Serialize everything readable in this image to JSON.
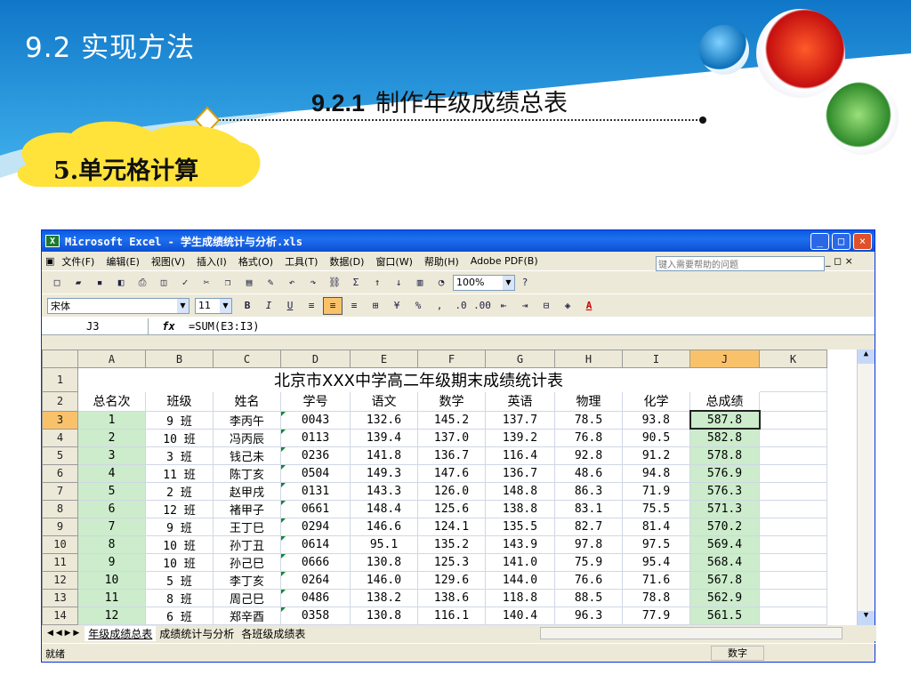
{
  "slide": {
    "section_title": "9.2  实现方法",
    "subtitle_num": "9.2.1",
    "subtitle_text": "制作年级成绩总表",
    "cloud_label": "5.单元格计算"
  },
  "window": {
    "title": "Microsoft Excel - 学生成绩统计与分析.xls",
    "buttons": {
      "minimize": "_",
      "maximize": "□",
      "close": "×"
    }
  },
  "menu": {
    "items": [
      "文件(F)",
      "编辑(E)",
      "视图(V)",
      "插入(I)",
      "格式(O)",
      "工具(T)",
      "数据(D)",
      "窗口(W)",
      "帮助(H)",
      "Adobe PDF(B)"
    ],
    "ask_placeholder": "键入需要帮助的问题",
    "doc_controls": "▾ _ ◻ ×"
  },
  "toolbar": {
    "zoom": "100%",
    "font_name": "宋体",
    "font_size": "11",
    "bold": "B",
    "italic": "I",
    "underline": "U",
    "percent": "%",
    "comma": ",",
    "sigma": "Σ"
  },
  "formula_bar": {
    "name_box": "J3",
    "fx": "fx",
    "formula": "=SUM(E3:I3)"
  },
  "columns": [
    "A",
    "B",
    "C",
    "D",
    "E",
    "F",
    "G",
    "H",
    "I",
    "J",
    "K"
  ],
  "sheet": {
    "title": "北京市XXX中学高二年级期末成绩统计表",
    "headers": [
      "总名次",
      "班级",
      "姓名",
      "学号",
      "语文",
      "数学",
      "英语",
      "物理",
      "化学",
      "总成绩"
    ],
    "rows": [
      [
        "1",
        "9 班",
        "李丙午",
        "0043",
        "132.6",
        "145.2",
        "137.7",
        "78.5",
        "93.8",
        "587.8"
      ],
      [
        "2",
        "10 班",
        "冯丙辰",
        "0113",
        "139.4",
        "137.0",
        "139.2",
        "76.8",
        "90.5",
        "582.8"
      ],
      [
        "3",
        "3 班",
        "钱己未",
        "0236",
        "141.8",
        "136.7",
        "116.4",
        "92.8",
        "91.2",
        "578.8"
      ],
      [
        "4",
        "11 班",
        "陈丁亥",
        "0504",
        "149.3",
        "147.6",
        "136.7",
        "48.6",
        "94.8",
        "576.9"
      ],
      [
        "5",
        "2 班",
        "赵甲戌",
        "0131",
        "143.3",
        "126.0",
        "148.8",
        "86.3",
        "71.9",
        "576.3"
      ],
      [
        "6",
        "12 班",
        "褚甲子",
        "0661",
        "148.4",
        "125.6",
        "138.8",
        "83.1",
        "75.5",
        "571.3"
      ],
      [
        "7",
        "9 班",
        "王丁巳",
        "0294",
        "146.6",
        "124.1",
        "135.5",
        "82.7",
        "81.4",
        "570.2"
      ],
      [
        "8",
        "10 班",
        "孙丁丑",
        "0614",
        "95.1",
        "135.2",
        "143.9",
        "97.8",
        "97.5",
        "569.4"
      ],
      [
        "9",
        "10 班",
        "孙己巳",
        "0666",
        "130.8",
        "125.3",
        "141.0",
        "75.9",
        "95.4",
        "568.4"
      ],
      [
        "10",
        "5 班",
        "李丁亥",
        "0264",
        "146.0",
        "129.6",
        "144.0",
        "76.6",
        "71.6",
        "567.8"
      ],
      [
        "11",
        "8 班",
        "周己巳",
        "0486",
        "138.2",
        "138.6",
        "118.8",
        "88.5",
        "78.8",
        "562.9"
      ],
      [
        "12",
        "6 班",
        "郑辛酉",
        "0358",
        "130.8",
        "116.1",
        "140.4",
        "96.3",
        "77.9",
        "561.5"
      ]
    ]
  },
  "sheet_tabs": [
    "年级成绩总表",
    "成绩统计与分析",
    "各班级成绩表"
  ],
  "status": {
    "ready": "就绪",
    "numlock": "数字"
  },
  "colors": {
    "header_blue": "#1a8fd8",
    "excel_blue": "#0a5ae0",
    "cell_green": "#cceccc",
    "selection_orange": "#f9c26a"
  }
}
